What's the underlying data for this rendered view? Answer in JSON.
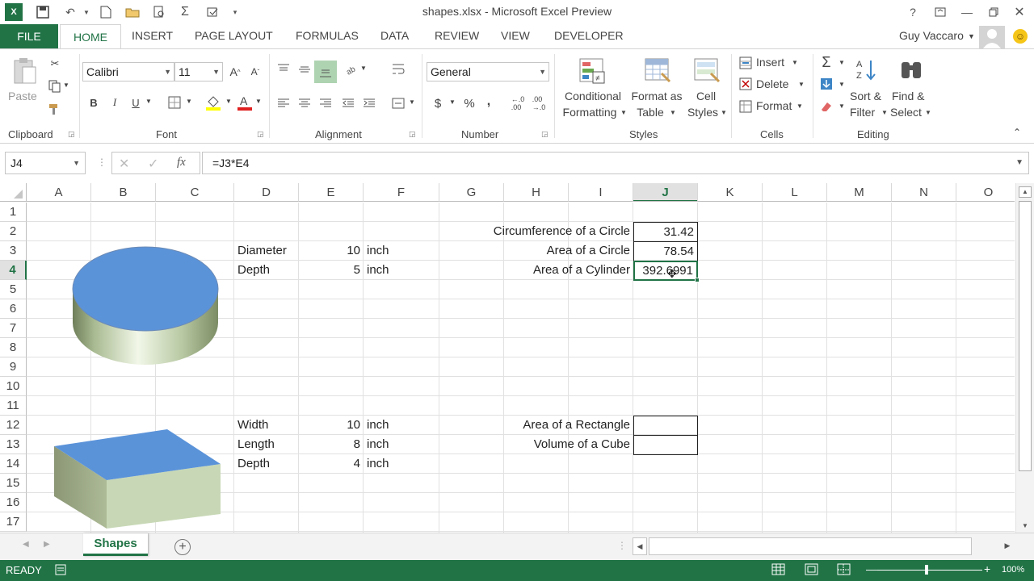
{
  "window": {
    "title": "shapes.xlsx - Microsoft Excel Preview",
    "user": "Guy Vaccaro",
    "help": "?"
  },
  "tabs": {
    "file": "FILE",
    "home": "HOME",
    "insert": "INSERT",
    "page_layout": "PAGE LAYOUT",
    "formulas": "FORMULAS",
    "data": "DATA",
    "review": "REVIEW",
    "view": "VIEW",
    "developer": "DEVELOPER"
  },
  "ribbon": {
    "clipboard": {
      "label": "Clipboard",
      "paste": "Paste"
    },
    "font": {
      "label": "Font",
      "family": "Calibri",
      "size": "11",
      "bold": "B",
      "italic": "I",
      "underline": "U"
    },
    "alignment": {
      "label": "Alignment"
    },
    "number": {
      "label": "Number",
      "format": "General",
      "currency": "$",
      "percent": "%",
      "comma": ","
    },
    "styles": {
      "label": "Styles",
      "conditional": [
        "Conditional",
        "Formatting"
      ],
      "format_table": [
        "Format as",
        "Table"
      ],
      "cell_styles": [
        "Cell",
        "Styles"
      ]
    },
    "cells": {
      "label": "Cells",
      "insert": "Insert",
      "delete": "Delete",
      "format": "Format"
    },
    "editing": {
      "label": "Editing",
      "sort": [
        "Sort &",
        "Filter"
      ],
      "find": [
        "Find &",
        "Select"
      ]
    }
  },
  "formula_bar": {
    "name_box": "J4",
    "fx": "fx",
    "formula": "=J3*E4"
  },
  "columns": [
    "A",
    "B",
    "C",
    "D",
    "E",
    "F",
    "G",
    "H",
    "I",
    "J",
    "K",
    "L",
    "M",
    "N",
    "O"
  ],
  "rows": [
    "1",
    "2",
    "3",
    "4",
    "5",
    "6",
    "7",
    "8",
    "9",
    "10",
    "11",
    "12",
    "13",
    "14",
    "15",
    "16",
    "17"
  ],
  "cells": {
    "D3": "Diameter",
    "E3": "10",
    "F3": "inch",
    "D4": "Depth",
    "E4": "5",
    "F4": "inch",
    "H2": "Circumference of a Circle",
    "J2": "31.42",
    "H3": "Area of a Circle",
    "J3": "78.54",
    "H4": "Area of a Cylinder",
    "J4": "392.6991",
    "D12": "Width",
    "E12": "10",
    "F12": "inch",
    "D13": "Length",
    "E13": "8",
    "F13": "inch",
    "D14": "Depth",
    "E14": "4",
    "F14": "inch",
    "H12": "Area of a Rectangle",
    "J12": "",
    "H13": "Volume of a Cube",
    "J13": ""
  },
  "sheet_tab": "Shapes",
  "status": {
    "ready": "READY",
    "zoom": "100%"
  },
  "colors": {
    "accent": "#217346",
    "shape_top": "#5b93d9",
    "shape_side": "#c8d8b6"
  }
}
